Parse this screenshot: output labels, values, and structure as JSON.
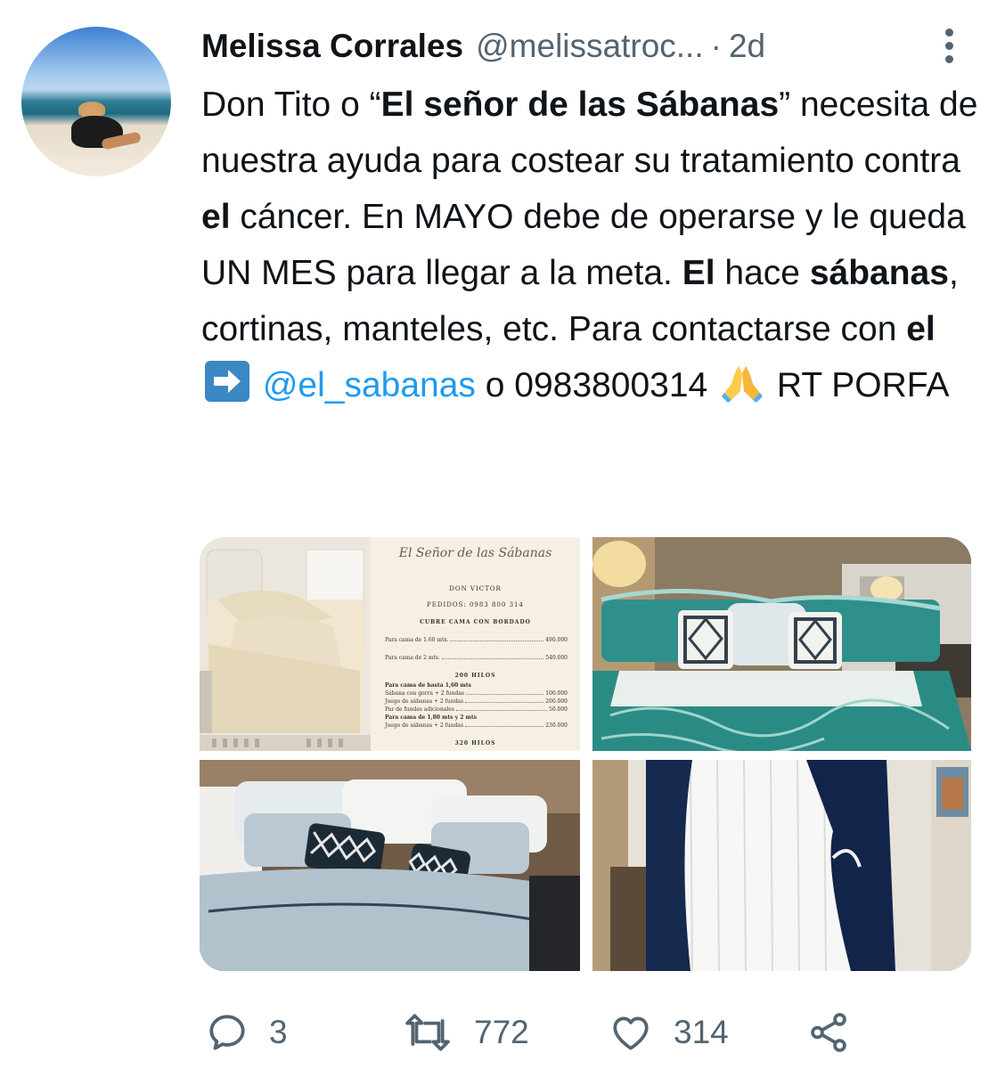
{
  "tweet": {
    "author": {
      "name": "Melissa Corrales",
      "handle": "@melissatroc...",
      "separator": "·",
      "time": "2d"
    },
    "text": {
      "t1": "Don Tito o “",
      "b1": "El señor de las Sábanas",
      "t2": "” necesita de nuestra ayuda para costear su tratamiento contra ",
      "b2": "el",
      "t3": " cáncer. En MAYO debe de operarse y le queda UN MES para llegar a la meta. ",
      "b3": "El",
      "t4": " hace ",
      "b4": "sábanas",
      "t5": ", cortinas, manteles, etc. Para contactarse con ",
      "b5": "el",
      "mention": "@el_sabanas",
      "t6": " o 0983800314 ",
      "t7": " RT PORFA"
    },
    "media": {
      "flyer": {
        "title": "El Señor de las Sábanas",
        "name": "DON VICTOR",
        "phone": "PEDIDOS: 0983 800 314",
        "section1": "CUBRE CAMA CON BORDADO",
        "section2": "200 HILOS",
        "section3": "320 HILOS",
        "lines": [
          {
            "label": "Para cama de 1.60 mts.",
            "price": "490.000"
          },
          {
            "label": "Para cama de 2 mts.",
            "price": "540.000"
          },
          {
            "label": "Para cama de hasta 1,60 mts",
            "price": ""
          },
          {
            "label": "Sábana con gorra + 2 fundas",
            "price": "100.000"
          },
          {
            "label": "Juego de sábanas + 2 fundas",
            "price": "200.000"
          },
          {
            "label": "Par de fundas adicionales",
            "price": "50.000"
          },
          {
            "label": "Para cama de 1,80 mts y 2 mts",
            "price": ""
          },
          {
            "label": "Juego de sábanas + 2 fundas",
            "price": "230.000"
          }
        ]
      }
    },
    "actions": {
      "replies": "3",
      "retweets": "772",
      "likes": "314"
    }
  },
  "icons": {
    "reply": "reply-icon",
    "retweet": "retweet-icon",
    "like": "heart-icon",
    "share": "share-icon",
    "more": "more-icon"
  },
  "colors": {
    "link": "#1d9bf0",
    "secondary": "#536471",
    "text": "#0f1419"
  }
}
